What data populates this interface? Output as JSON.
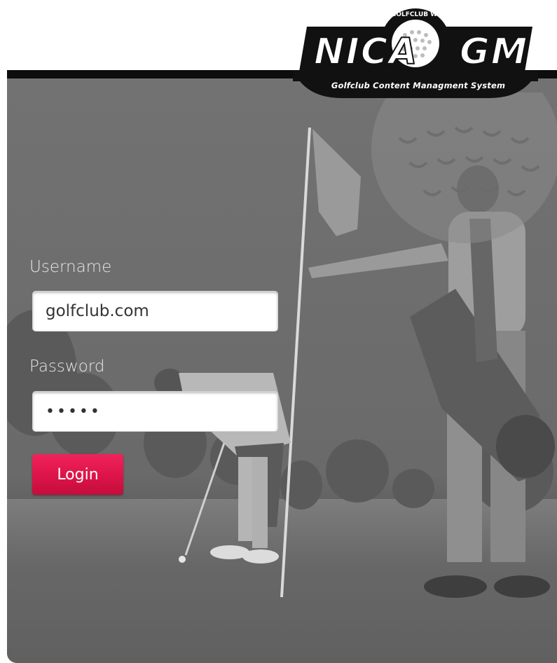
{
  "logo": {
    "word_left": "NICA",
    "word_right": "GM",
    "arc_text": "GOLFCLUB WEBMANAGER",
    "tagline": "Golfclub Content Managment System"
  },
  "form": {
    "username_label": "Username",
    "username_value": "golfclub.com",
    "password_label": "Password",
    "password_value": "•••••",
    "login_label": "Login"
  },
  "colors": {
    "accent": "#e0174c",
    "header_bar": "#0d0d0d",
    "background": "#6b6b6b"
  }
}
